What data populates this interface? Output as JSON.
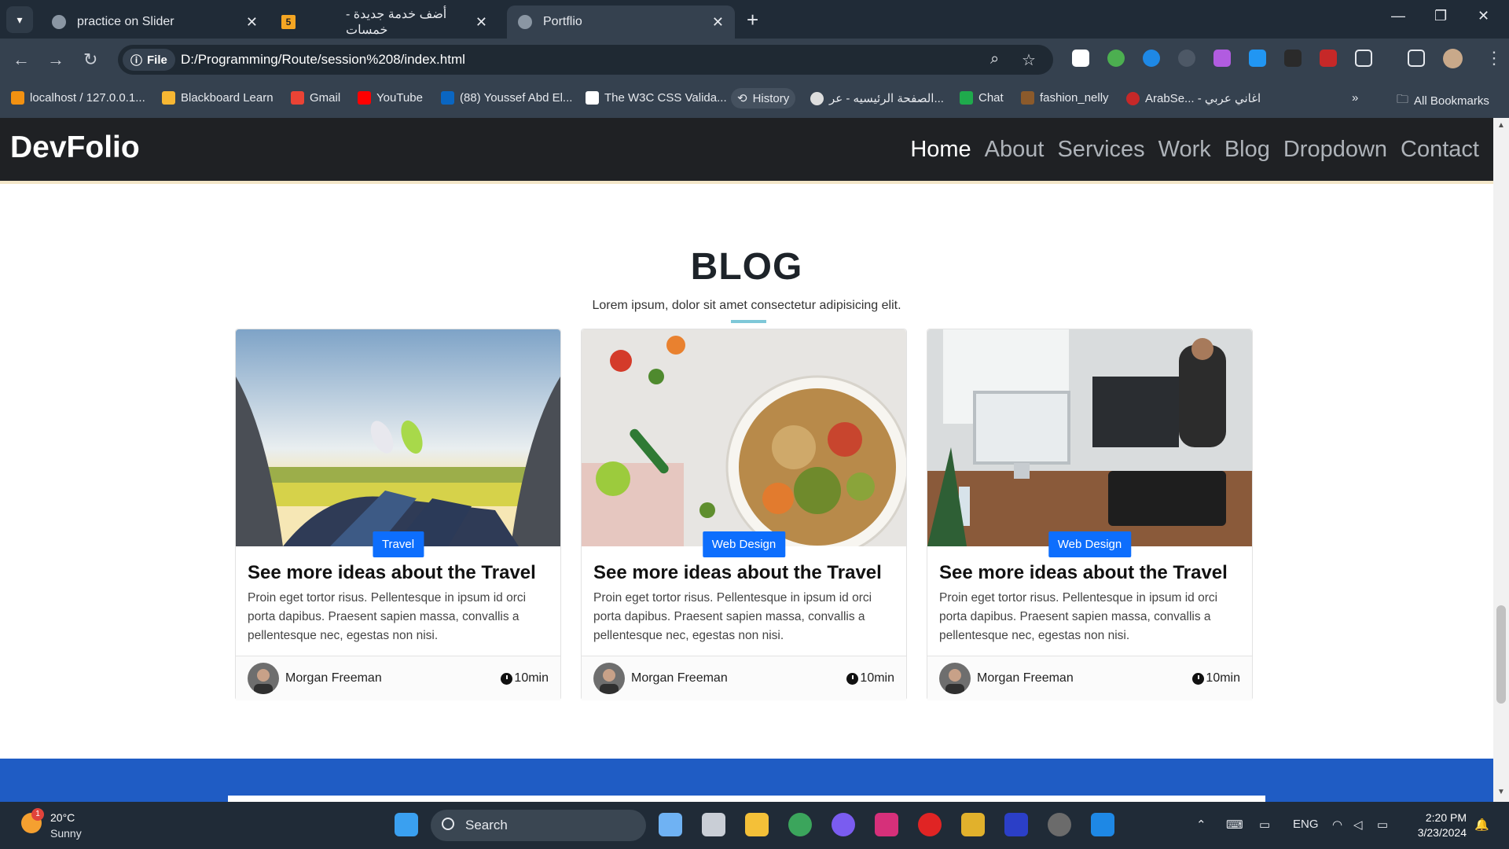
{
  "browser": {
    "tabs": [
      {
        "title": "practice on Slider",
        "active": false
      },
      {
        "title": "أضف خدمة جديدة - خمسات",
        "active": false,
        "favicon_text": "5"
      },
      {
        "title": "Portflio",
        "active": true
      }
    ],
    "url_chip": "File",
    "url": "D:/Programming/Route/session%208/index.html",
    "bookmarks": [
      "localhost / 127.0.0.1...",
      "Blackboard Learn",
      "Gmail",
      "YouTube",
      "(88) Youssef Abd El...",
      "The W3C CSS Valida...",
      "History",
      "الصفحة الرئيسيه - عر...",
      "Chat",
      "fashion_nelly",
      "ArabSe... - اغاني عربي",
      "All Bookmarks"
    ]
  },
  "site": {
    "brand": "DevFolio",
    "menu": [
      "Home",
      "About",
      "Services",
      "Work",
      "Blog",
      "Dropdown",
      "Contact"
    ],
    "active_menu": "Home",
    "blog": {
      "title": "BLOG",
      "subtitle": "Lorem ipsum, dolor sit amet consectetur adipisicing elit.",
      "cards": [
        {
          "badge": "Travel",
          "title": "See more ideas about the Travel",
          "text": "Proin eget tortor risus. Pellentesque in ipsum id orci porta dapibus. Praesent sapien massa, convallis a pellentesque nec, egestas non nisi.",
          "author": "Morgan Freeman",
          "time": "10min"
        },
        {
          "badge": "Web Design",
          "title": "See more ideas about the Travel",
          "text": "Proin eget tortor risus. Pellentesque in ipsum id orci porta dapibus. Praesent sapien massa, convallis a pellentesque nec, egestas non nisi.",
          "author": "Morgan Freeman",
          "time": "10min"
        },
        {
          "badge": "Web Design",
          "title": "See more ideas about the Travel",
          "text": "Proin eget tortor risus. Pellentesque in ipsum id orci porta dapibus. Praesent sapien massa, convallis a pellentesque nec, egestas non nisi.",
          "author": "Morgan Freeman",
          "time": "10min"
        }
      ]
    }
  },
  "taskbar": {
    "weather_temp": "20°C",
    "weather_desc": "Sunny",
    "weather_badge": "1",
    "search": "Search",
    "lang": "ENG",
    "time": "2:20 PM",
    "date": "3/23/2024"
  },
  "colors": {
    "accent": "#0d6efd",
    "nav_bg": "#1f2124",
    "footer_band": "#1f5cc4"
  }
}
